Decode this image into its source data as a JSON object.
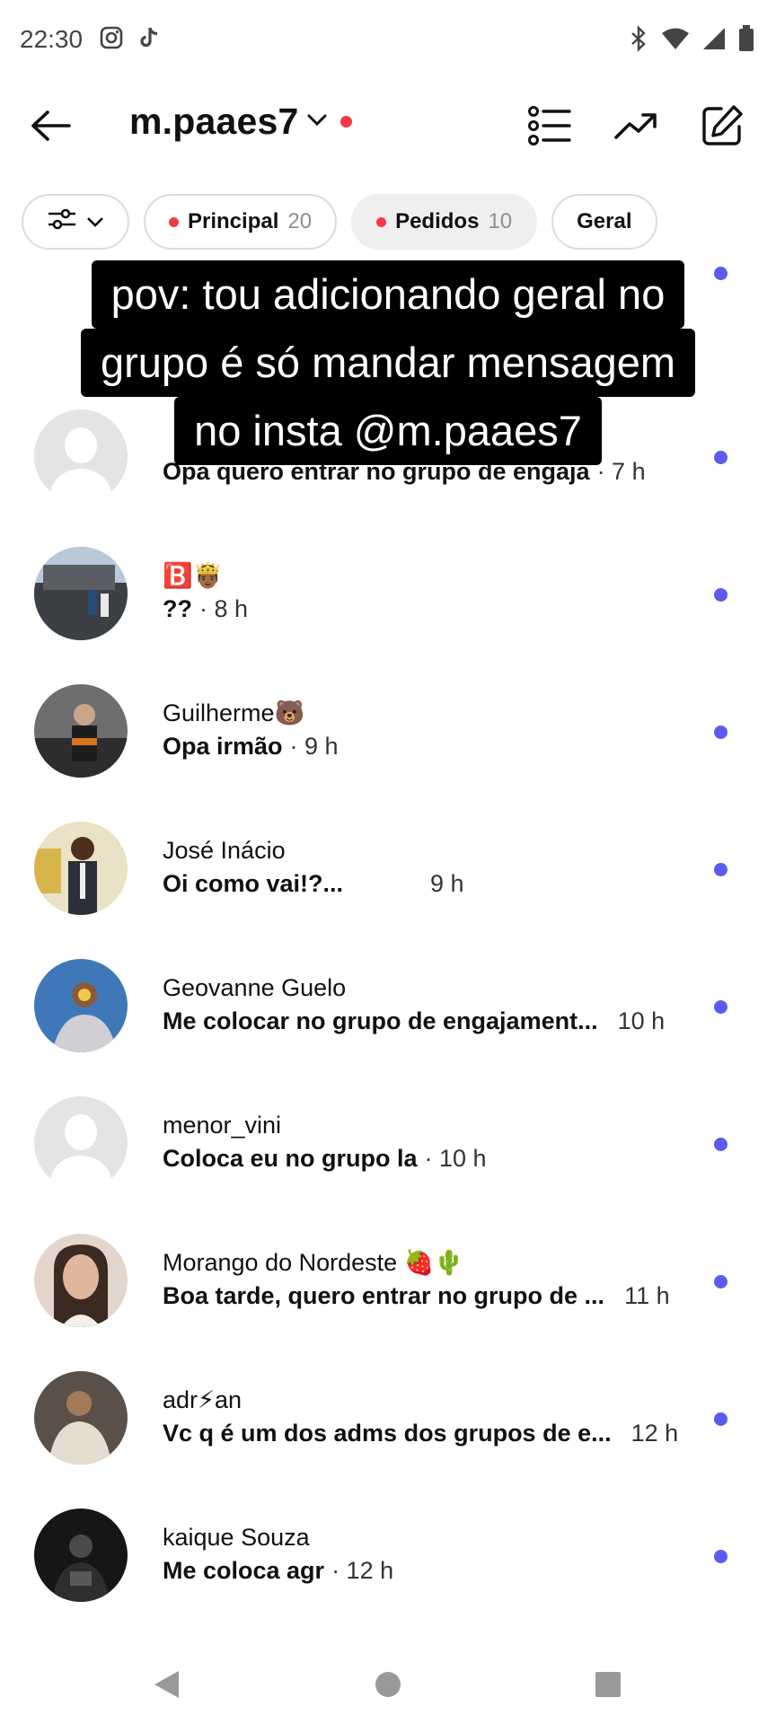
{
  "status_bar": {
    "time": "22:30",
    "left_icons": [
      "instagram-icon",
      "tiktok-icon"
    ],
    "right_icons": [
      "bluetooth-icon",
      "wifi-icon",
      "signal-icon",
      "battery-icon"
    ]
  },
  "header": {
    "account_name": "m.paaes7",
    "icons": [
      "back-arrow-icon",
      "chevron-down-icon",
      "list-icon",
      "trending-icon",
      "compose-icon"
    ]
  },
  "chips": [
    {
      "label": "",
      "icon": "filter-icon"
    },
    {
      "label": "Principal",
      "count": "20"
    },
    {
      "label": "Pedidos",
      "count": "10"
    },
    {
      "label": "Geral"
    }
  ],
  "caption": {
    "line1": "pov: tou adicionando geral no",
    "line2": "grupo é só mandar mensagem",
    "line3": "no insta @m.paaes7"
  },
  "threads": [
    {
      "name": "",
      "message": "Opa quero entrar no grupo de engaja",
      "time": "· 7 h",
      "avatar": "default",
      "unread": true
    },
    {
      "name": "🅱️🤴🏾",
      "message": "??",
      "time": "· 8 h",
      "avatar": "photo",
      "unread": true
    },
    {
      "name": "Guilherme🐻",
      "message": "Opa irmão",
      "time": "· 9 h",
      "avatar": "photo",
      "unread": true
    },
    {
      "name": "José Inácio",
      "message": "Oi como vai!?...",
      "time": "9 h",
      "avatar": "photo",
      "unread": true
    },
    {
      "name": "Geovanne Guelo",
      "message": "Me colocar no grupo de engajament...",
      "time": "10 h",
      "avatar": "photo",
      "unread": true
    },
    {
      "name": "menor_vini",
      "message": "Coloca eu no grupo la",
      "time": "· 10 h",
      "avatar": "default",
      "unread": true
    },
    {
      "name": "Morango do Nordeste 🍓🌵",
      "message": "Boa tarde, quero entrar no grupo de ...",
      "time": "11 h",
      "avatar": "photo",
      "unread": true
    },
    {
      "name": "adr⚡an",
      "message": "Vc q é um dos adms dos grupos de e...",
      "time": "12 h",
      "avatar": "photo",
      "unread": true
    },
    {
      "name": "kaique Souza",
      "message": "Me coloca agr",
      "time": "· 12 h",
      "avatar": "photo",
      "unread": true
    }
  ],
  "colors": {
    "accent_unread": "#5b5bf0",
    "notification_red": "#f23a4b"
  },
  "navbar": [
    "back-triangle-icon",
    "home-circle-icon",
    "recents-square-icon"
  ]
}
